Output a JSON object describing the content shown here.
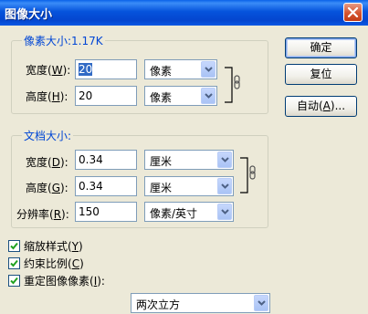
{
  "window": {
    "title": "图像大小"
  },
  "pixel_dimensions": {
    "title": "像素大小:1.17K",
    "width": {
      "label": "宽度(",
      "key": "W",
      "suffix": "):",
      "value": "20",
      "unit": "像素"
    },
    "height": {
      "label": "高度(",
      "key": "H",
      "suffix": "):",
      "value": "20",
      "unit": "像素"
    }
  },
  "document_size": {
    "title": "文档大小:",
    "width": {
      "label": "宽度(",
      "key": "D",
      "suffix": "):",
      "value": "0.34",
      "unit": "厘米"
    },
    "height": {
      "label": "高度(",
      "key": "G",
      "suffix": "):",
      "value": "0.34",
      "unit": "厘米"
    },
    "resolution": {
      "label": "分辨率(",
      "key": "R",
      "suffix": "):",
      "value": "150",
      "unit": "像素/英寸"
    }
  },
  "buttons": {
    "ok": "确定",
    "reset": "复位",
    "auto": {
      "label": "自动(",
      "key": "A",
      "suffix": ")..."
    }
  },
  "options": {
    "scale_styles": {
      "label": "缩放样式(",
      "key": "Y",
      "suffix": ")",
      "checked": true
    },
    "constrain": {
      "label": "约束比例(",
      "key": "C",
      "suffix": ")",
      "checked": true
    },
    "resample": {
      "label": "重定图像像素(",
      "key": "I",
      "suffix": "):",
      "checked": true
    },
    "resample_method": "两次立方"
  },
  "colors": {
    "group_title": "#0046d5",
    "titlebar": "#0553dc",
    "dialog_bg": "#ece9d8"
  }
}
